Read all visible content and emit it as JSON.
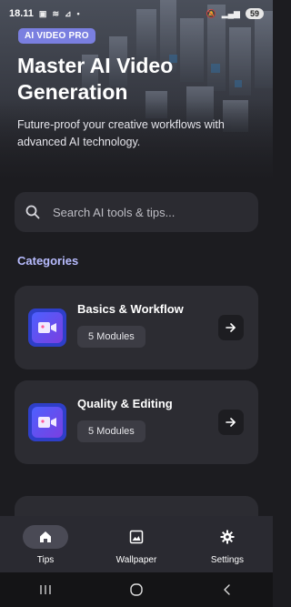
{
  "status": {
    "time": "18.11",
    "battery": "59"
  },
  "hero": {
    "badge": "AI VIDEO PRO",
    "title": "Master AI Video Generation",
    "subtitle": "Future-proof your creative workflows with advanced AI technology."
  },
  "search": {
    "placeholder": "Search AI tools & tips..."
  },
  "categories": {
    "title": "Categories",
    "items": [
      {
        "title": "Basics & Workflow",
        "count_label": "5 Modules"
      },
      {
        "title": "Quality & Editing",
        "count_label": "5 Modules"
      }
    ]
  },
  "bottom_nav": {
    "items": [
      {
        "label": "Tips",
        "icon": "home-icon",
        "active": true
      },
      {
        "label": "Wallpaper",
        "icon": "wallpaper-icon",
        "active": false
      },
      {
        "label": "Settings",
        "icon": "gear-icon",
        "active": false
      }
    ]
  },
  "colors": {
    "accent": "#b8bcff",
    "badge": "#7a7fe0",
    "background": "#1c1c20",
    "card": "#2c2c32"
  }
}
